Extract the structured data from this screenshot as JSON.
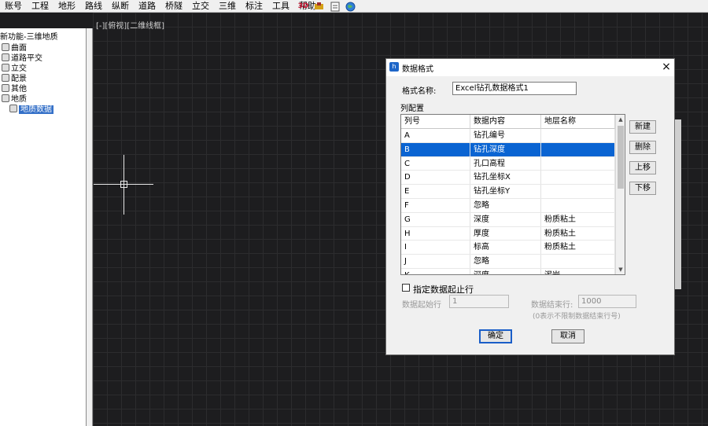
{
  "menu": {
    "items": [
      "账号",
      "工程",
      "地形",
      "路线",
      "纵断",
      "道路",
      "桥隧",
      "立交",
      "三维",
      "标注",
      "工具",
      "帮助"
    ],
    "tool_icons": [
      "3D",
      "road-icon",
      "document-icon",
      "globe-icon"
    ]
  },
  "tree": {
    "root": "新功能-三维地质",
    "items": [
      "曲面",
      "道路平交",
      "立交",
      "配景",
      "其他",
      "地质"
    ],
    "selected": "地质数据"
  },
  "viewport": {
    "label": "[-][俯视][二维线框]"
  },
  "dialog": {
    "title": "数据格式",
    "close": "×",
    "format_name_label": "格式名称:",
    "format_name_value": "Excel钻孔数据格式1",
    "columns_label": "列配置",
    "headers": [
      "列号",
      "数据内容",
      "地层名称"
    ],
    "rows": [
      [
        "A",
        "钻孔编号",
        ""
      ],
      [
        "B",
        "钻孔深度",
        ""
      ],
      [
        "C",
        "孔口高程",
        ""
      ],
      [
        "D",
        "钻孔坐标X",
        ""
      ],
      [
        "E",
        "钻孔坐标Y",
        ""
      ],
      [
        "F",
        "忽略",
        ""
      ],
      [
        "G",
        "深度",
        "粉质粘土"
      ],
      [
        "H",
        "厚度",
        "粉质粘土"
      ],
      [
        "I",
        "标高",
        "粉质粘土"
      ],
      [
        "J",
        "忽略",
        ""
      ],
      [
        "K",
        "深度",
        "泥岩"
      ]
    ],
    "selected_row": 1,
    "side_buttons": [
      "新建",
      "删除",
      "上移",
      "下移"
    ],
    "range_checkbox_label": "指定数据起止行",
    "start_row_label": "数据起始行",
    "start_row_value": "1",
    "end_row_label": "数据结束行:",
    "end_row_value": "1000",
    "end_row_hint": "(0表示不限制数据结束行号)",
    "ok": "确定",
    "cancel": "取消"
  }
}
